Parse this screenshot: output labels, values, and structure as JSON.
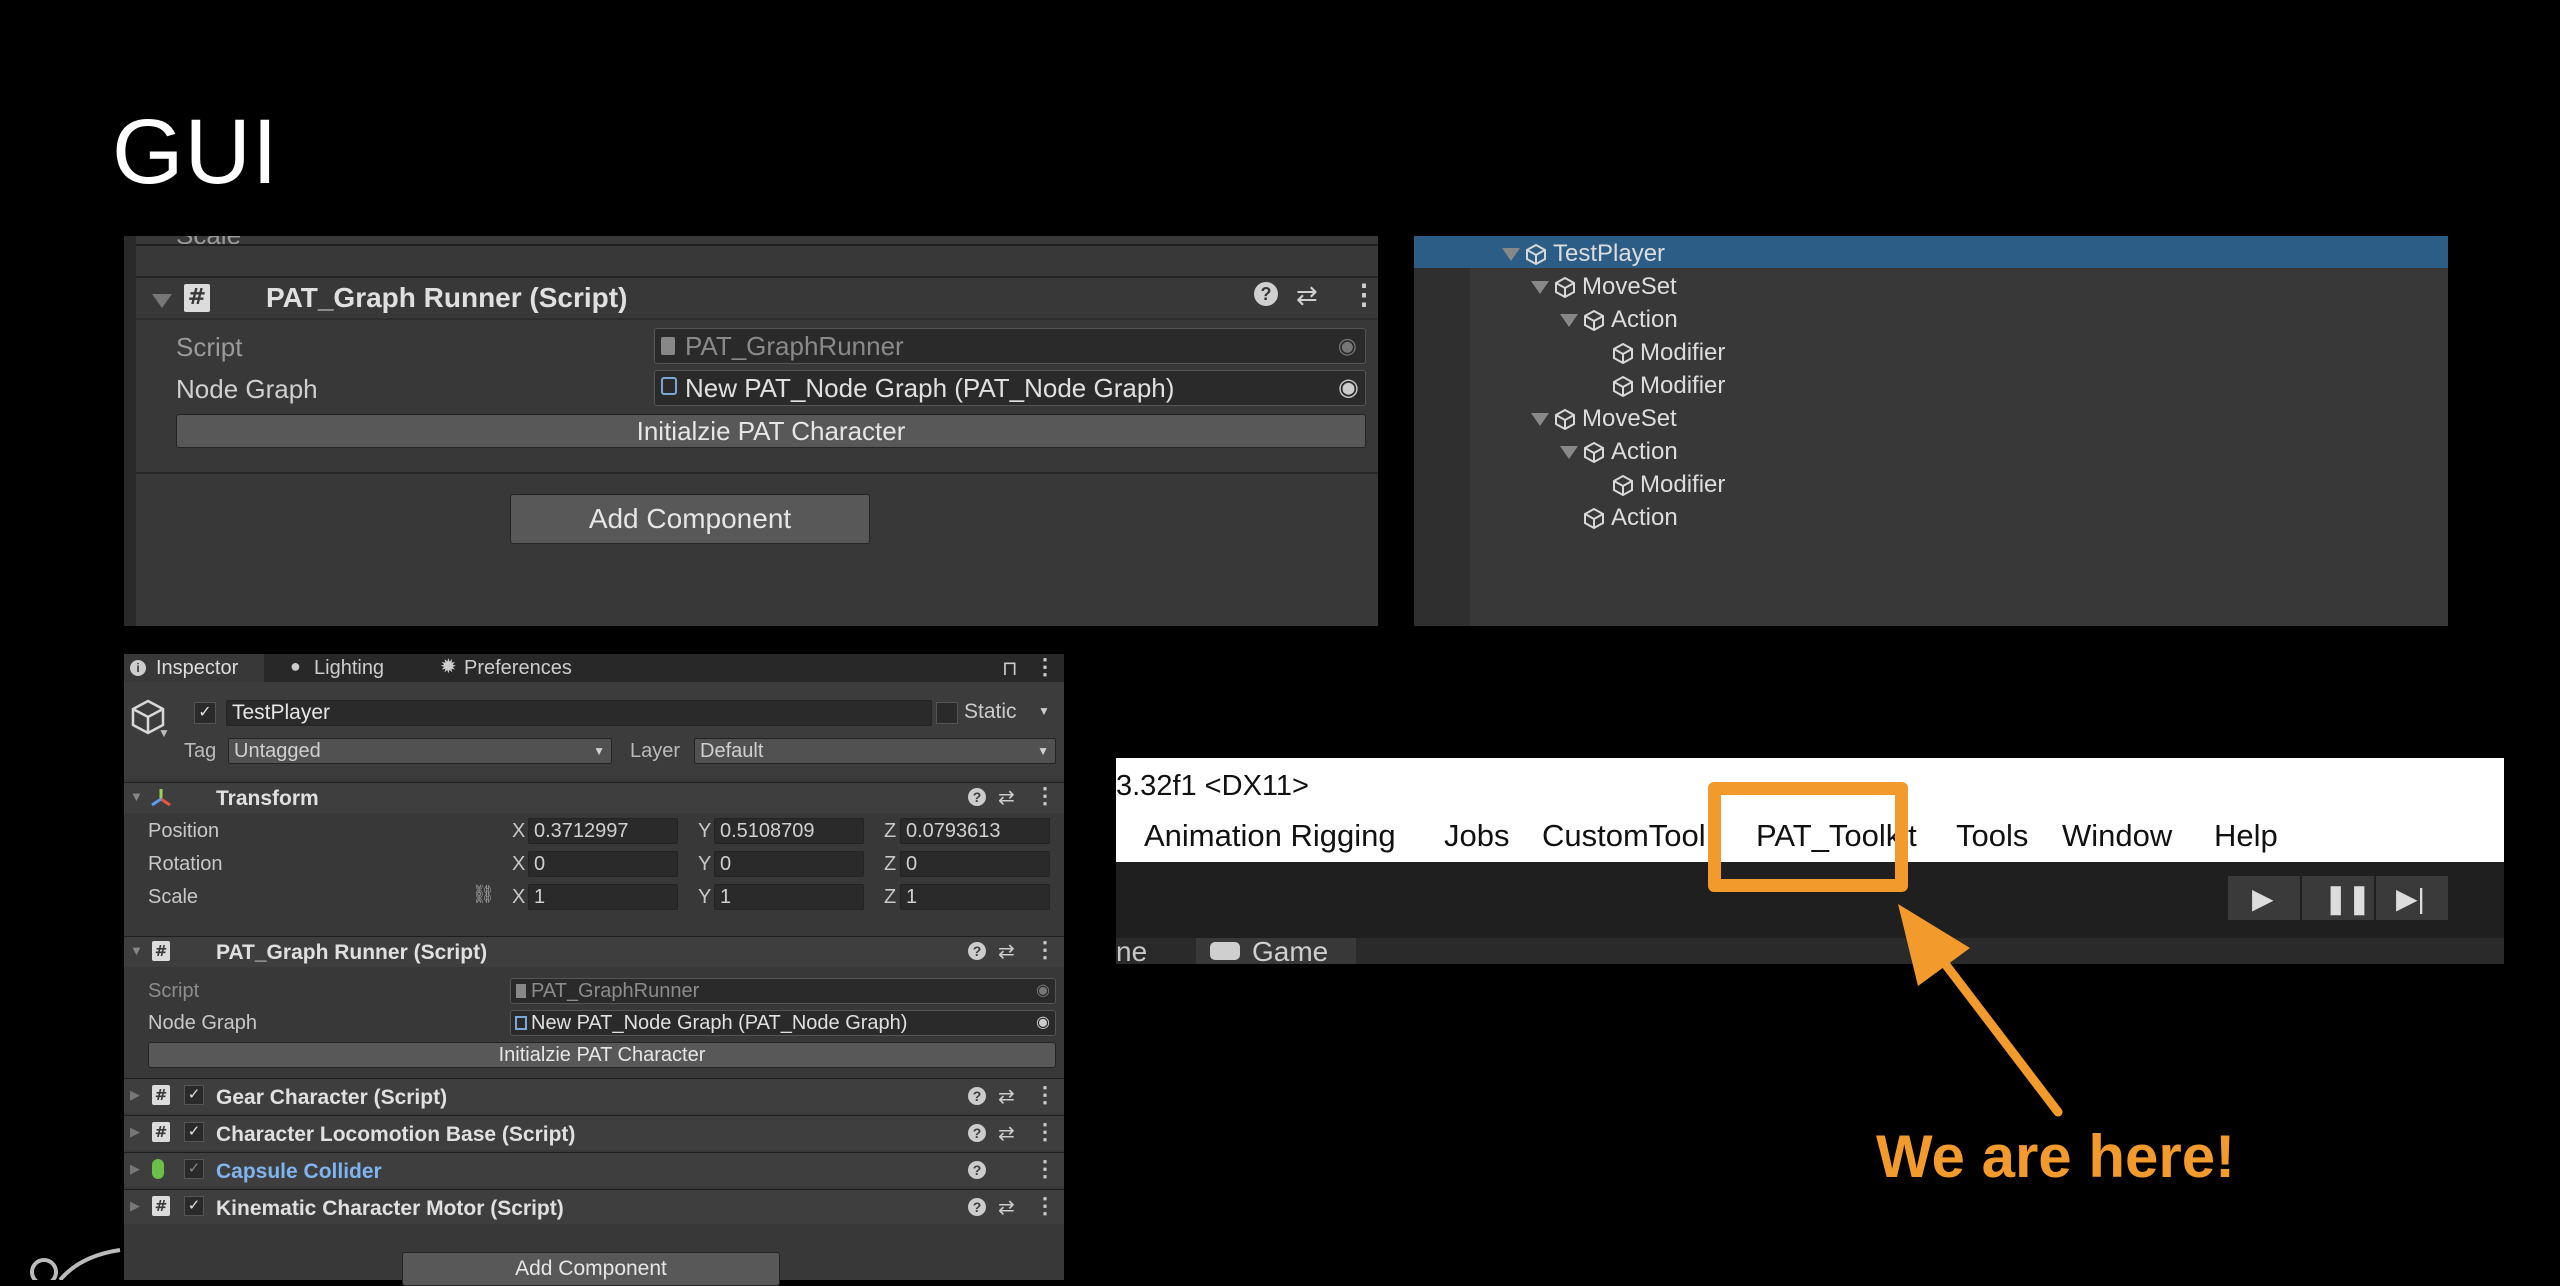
{
  "slide": {
    "title": "GUI",
    "annotation": "We are here!",
    "accent_color": "#f39a2c"
  },
  "top_inspector": {
    "cut_label": "Scale",
    "component_title": "PAT_Graph Runner (Script)",
    "script_label": "Script",
    "script_value": "PAT_GraphRunner",
    "node_graph_label": "Node Graph",
    "node_graph_value": "New PAT_Node Graph (PAT_Node Graph)",
    "init_button": "Initialzie PAT Character",
    "add_component": "Add Component",
    "icons": [
      "hash-icon",
      "help-icon",
      "sliders-icon",
      "kebab-icon",
      "target-icon"
    ]
  },
  "hierarchy": {
    "items": [
      {
        "label": "TestPlayer",
        "depth": 0,
        "expanded": true,
        "selected": true
      },
      {
        "label": "MoveSet",
        "depth": 1,
        "expanded": true
      },
      {
        "label": "Action",
        "depth": 2,
        "expanded": true
      },
      {
        "label": "Modifier",
        "depth": 3
      },
      {
        "label": "Modifier",
        "depth": 3
      },
      {
        "label": "MoveSet",
        "depth": 1,
        "expanded": true
      },
      {
        "label": "Action",
        "depth": 2,
        "expanded": true
      },
      {
        "label": "Modifier",
        "depth": 3
      },
      {
        "label": "Action",
        "depth": 2
      }
    ],
    "selected_color": "#2c5d87"
  },
  "inspector": {
    "tabs": [
      "Inspector",
      "Lighting",
      "Preferences"
    ],
    "object_name": "TestPlayer",
    "static_label": "Static",
    "tag_label": "Tag",
    "tag_value": "Untagged",
    "layer_label": "Layer",
    "layer_value": "Default",
    "transform": {
      "title": "Transform",
      "position": {
        "label": "Position",
        "x": "0.3712997",
        "y": "0.5108709",
        "z": "0.0793613"
      },
      "rotation": {
        "label": "Rotation",
        "x": "0",
        "y": "0",
        "z": "0"
      },
      "scale": {
        "label": "Scale",
        "x": "1",
        "y": "1",
        "z": "1"
      },
      "axis": [
        "X",
        "Y",
        "Z"
      ]
    },
    "graph_runner": {
      "title": "PAT_Graph Runner (Script)",
      "script_label": "Script",
      "script_value": "PAT_GraphRunner",
      "node_graph_label": "Node Graph",
      "node_graph_value": "New PAT_Node Graph (PAT_Node Graph)",
      "init_button": "Initialzie PAT Character"
    },
    "components": [
      {
        "title": "Gear Character (Script)"
      },
      {
        "title": "Character Locomotion Base (Script)"
      },
      {
        "title": "Capsule Collider"
      },
      {
        "title": "Kinematic Character Motor (Script)"
      }
    ],
    "add_component": "Add Component",
    "collider_color": "#7fb4f0"
  },
  "menubar": {
    "window_title": "3.32f1 <DX11>",
    "menus": [
      "Animation Rigging",
      "Jobs",
      "CustomTool",
      "PAT_Toolkit",
      "Tools",
      "Window",
      "Help"
    ],
    "highlight": "PAT_Toolkit",
    "view_tabs": [
      "ne",
      "Game"
    ],
    "play_controls": [
      "play-icon",
      "pause-icon",
      "step-icon"
    ]
  }
}
